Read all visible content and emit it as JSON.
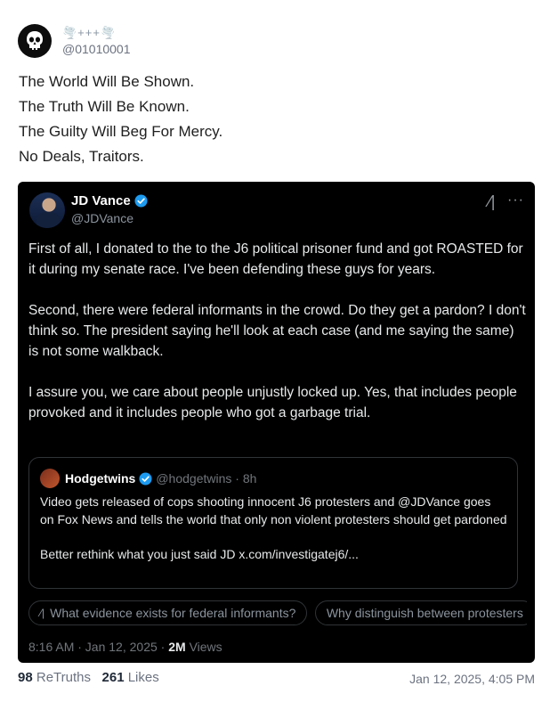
{
  "post": {
    "display_name": "🌪️+++🌪️",
    "handle": "@01010001",
    "text_lines": [
      "The World Will Be Shown.",
      "The Truth Will Be Known.",
      "The Guilty Will Beg For Mercy.",
      "No Deals, Traitors."
    ],
    "retruths_count": "98",
    "retruths_label": "ReTruths",
    "likes_count": "261",
    "likes_label": "Likes",
    "date": "Jan 12, 2025, 4:05 PM"
  },
  "embed": {
    "author_name": "JD Vance",
    "author_handle": "@JDVance",
    "paragraphs": [
      "First of all, I donated to the to the J6 political prisoner fund and got ROASTED for it during my senate race. I've been defending these guys for years.",
      "Second, there were federal informants in the crowd. Do they get a pardon? I don't think so. The president saying he'll look at each case (and me saying the same) is not some walkback.",
      "I assure you, we care about people unjustly locked up. Yes, that includes people provoked and it includes people who got a garbage trial."
    ],
    "quote": {
      "author_name": "Hodgetwins",
      "author_meta": "@hodgetwins · 8h",
      "paragraphs": [
        "Video gets released of cops shooting  innocent J6 protesters and @JDVance goes on Fox News and tells the world that only non violent protesters should get pardoned",
        "Better rethink what you just said JD x.com/investigatej6/..."
      ]
    },
    "chips": [
      "What evidence exists for federal informants?",
      "Why distinguish between protesters"
    ],
    "timestamp": "8:16 AM · Jan 12, 2025 · ",
    "views_count": "2M",
    "views_label": "Views"
  },
  "colors": {
    "embed_bg": "#000000",
    "verified": "#1d9bf0"
  }
}
